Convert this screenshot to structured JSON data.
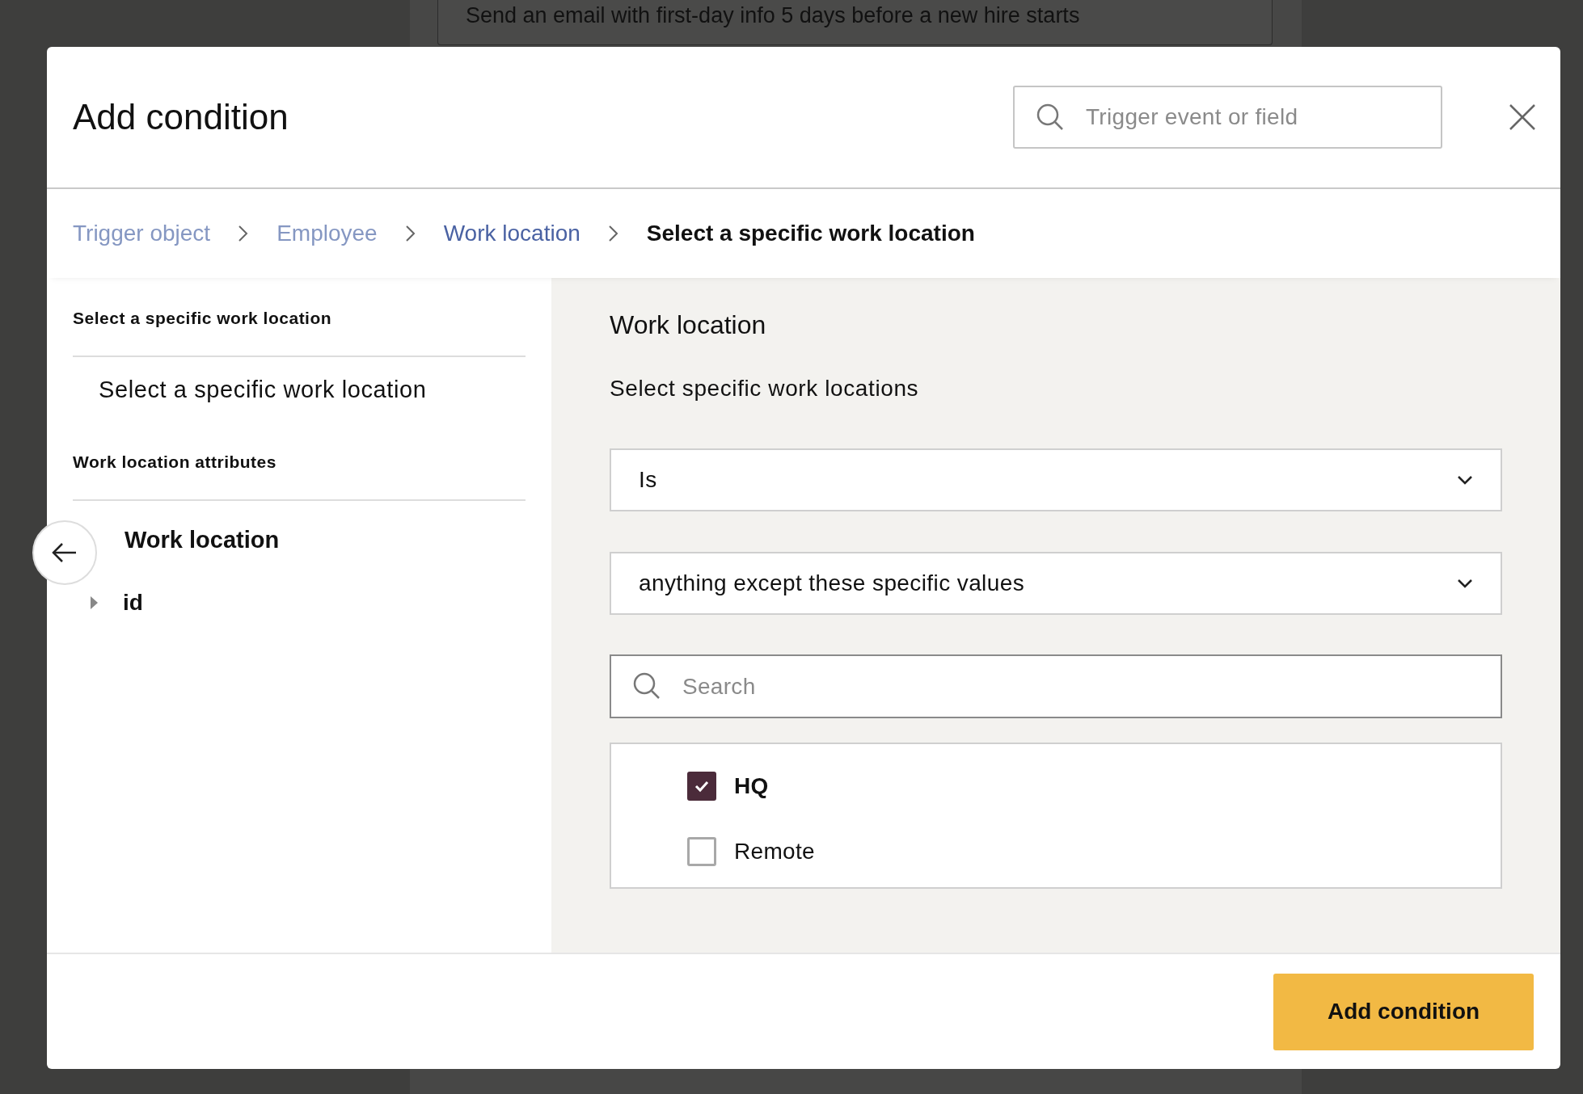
{
  "background": {
    "card_text": "Send an email with first-day info 5 days before a new hire starts"
  },
  "dialog": {
    "title": "Add condition",
    "search": {
      "placeholder": "Trigger event or field"
    }
  },
  "breadcrumb": [
    {
      "label": "Trigger object",
      "kind": "link"
    },
    {
      "label": "Employee",
      "kind": "link"
    },
    {
      "label": "Work location",
      "kind": "hovered"
    },
    {
      "label": "Select a specific work location",
      "kind": "current"
    }
  ],
  "sidebar": {
    "sections": [
      {
        "heading": "Select a specific work location",
        "items": [
          {
            "label": "Select a specific work location",
            "kind": "option"
          }
        ]
      },
      {
        "heading": "Work location attributes",
        "items": [
          {
            "label": "Work location",
            "kind": "title"
          },
          {
            "label": "id",
            "kind": "expandable",
            "expanded": false
          }
        ]
      }
    ]
  },
  "panel": {
    "heading": "Work location",
    "description": "Select specific work locations",
    "selects": [
      {
        "value": "Is"
      },
      {
        "value": "anything except these specific values"
      }
    ],
    "search": {
      "placeholder": "Search"
    },
    "options": [
      {
        "label": "HQ",
        "checked": true
      },
      {
        "label": "Remote",
        "checked": false
      }
    ]
  },
  "footer": {
    "button": "Add condition"
  }
}
